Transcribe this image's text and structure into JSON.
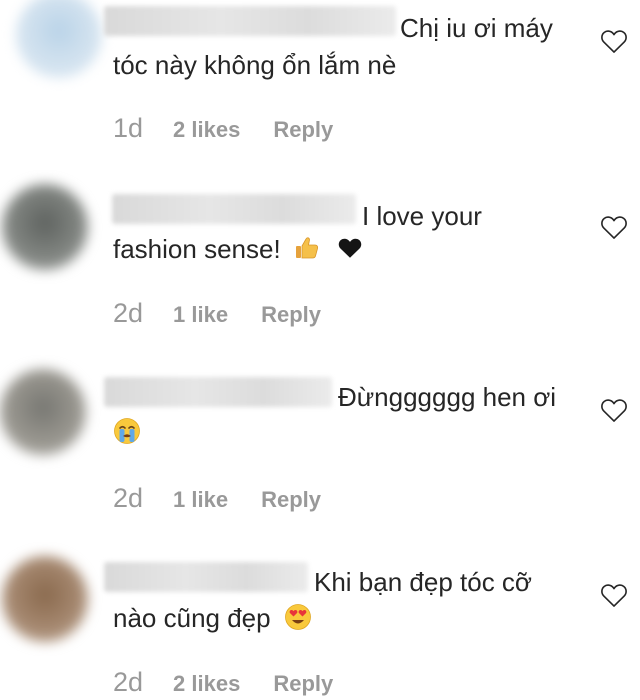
{
  "comments": [
    {
      "text_line1": "Chị iu ơi máy",
      "text_line2": "tóc này không ổn lắm nè",
      "time": "1d",
      "likes": "2 likes",
      "reply": "Reply"
    },
    {
      "text_line1": "I love your",
      "text_line2": "fashion sense!",
      "emojis": [
        "thumbs-up-emoji",
        "black-heart-emoji"
      ],
      "time": "2d",
      "likes": "1 like",
      "reply": "Reply"
    },
    {
      "text_line1": "Đừngggggg hen ơi",
      "emojis": [
        "crying-face-emoji"
      ],
      "time": "2d",
      "likes": "1 like",
      "reply": "Reply"
    },
    {
      "text_line1": "Khi bạn đẹp tóc cỡ",
      "text_line2": "nào cũng đẹp",
      "emojis": [
        "heart-eyes-emoji"
      ],
      "time": "2d",
      "likes": "2 likes",
      "reply": "Reply"
    }
  ],
  "icons": {
    "like": "heart-outline-icon"
  },
  "colors": {
    "text": "#262626",
    "meta": "#999999",
    "heart_outline": "#262626",
    "background": "#ffffff"
  }
}
